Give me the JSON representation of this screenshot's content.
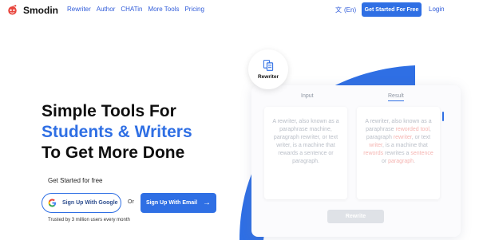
{
  "nav": {
    "brand": "Smodin",
    "links": [
      "Rewriter",
      "Author",
      "CHATin",
      "More Tools",
      "Pricing"
    ],
    "language": "(En)",
    "cta_label": "Get Started For Free",
    "login_label": "Login"
  },
  "hero": {
    "title_line1": "Simple Tools For",
    "title_line2": "Students & Writers",
    "title_line3": "To Get More Done",
    "get_started_label": "Get Started for free",
    "google_button": "Sign Up With Google",
    "or_label": "Or",
    "email_button": "Sign Up With Email",
    "trusted_text": "Trusted by 3 million users every month"
  },
  "demo": {
    "badge_label": "Rewriter",
    "tab_input": "Input",
    "tab_result": "Result",
    "input_text": "A rewriter, also known as a paraphrase machine, paragraph rewriter, or text writer, is a machine that rewards a sentence or paragraph.",
    "result_segments": [
      {
        "text": "A rewriter, also known as a paraphrase ",
        "hl": false
      },
      {
        "text": "reworded tool",
        "hl": true
      },
      {
        "text": ", paragraph ",
        "hl": false
      },
      {
        "text": "rewriter",
        "hl": true
      },
      {
        "text": ", or text ",
        "hl": false
      },
      {
        "text": "writer",
        "hl": true
      },
      {
        "text": ", is a machine that ",
        "hl": false
      },
      {
        "text": "rewords",
        "hl": true
      },
      {
        "text": " rewrites a ",
        "hl": false
      },
      {
        "text": "sentence",
        "hl": true
      },
      {
        "text": " or ",
        "hl": false
      },
      {
        "text": "paragraph",
        "hl": true
      },
      {
        "text": ".",
        "hl": false
      }
    ],
    "rewrite_button": "Rewrite"
  },
  "colors": {
    "accent": "#2f6fe4",
    "logo_red": "#e8453c"
  }
}
